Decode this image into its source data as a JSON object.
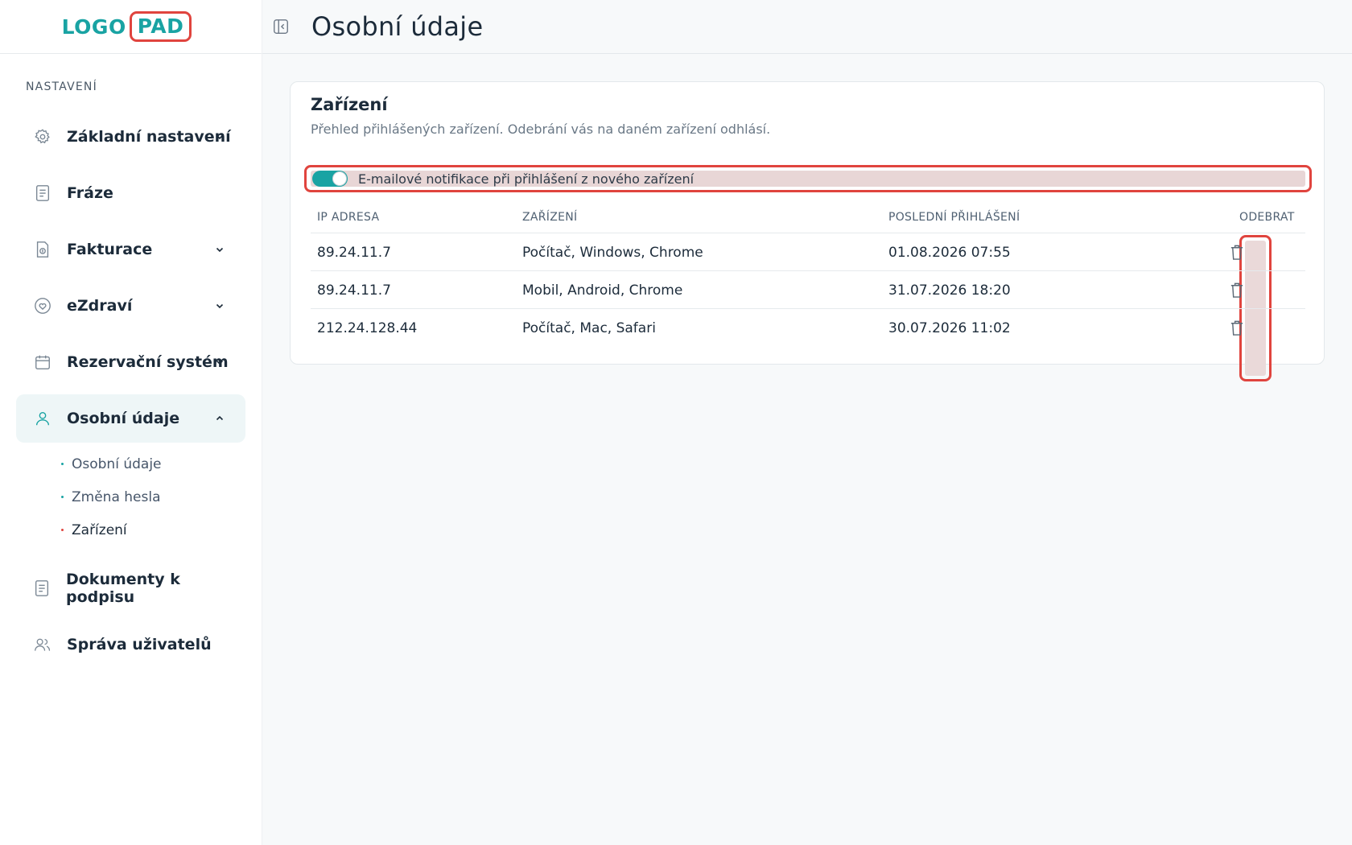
{
  "logo": {
    "part1": "LOGO",
    "part2": "PAD"
  },
  "header": {
    "title": "Osobní údaje"
  },
  "sidebar": {
    "section_label": "NASTAVENÍ",
    "items": [
      {
        "label": "Základní nastavení",
        "icon": "gear-icon"
      },
      {
        "label": "Fráze",
        "icon": "document-icon"
      },
      {
        "label": "Fakturace",
        "icon": "invoice-icon"
      },
      {
        "label": "eZdraví",
        "icon": "heart-icon"
      },
      {
        "label": "Rezervační systém",
        "icon": "calendar-icon"
      },
      {
        "label": "Osobní údaje",
        "icon": "user-icon"
      },
      {
        "label": "Dokumenty k podpisu",
        "icon": "document-icon"
      },
      {
        "label": "Správa uživatelů",
        "icon": "users-icon"
      }
    ],
    "subitems": [
      {
        "label": "Osobní údaje"
      },
      {
        "label": "Změna hesla"
      },
      {
        "label": "Zařízení"
      }
    ]
  },
  "card": {
    "title": "Zařízení",
    "description": "Přehled přihlášených zařízení. Odebrání vás na daném zařízení odhlásí.",
    "notification": {
      "label": "E-mailové notifikace při přihlášení z nového zařízení",
      "enabled": true
    },
    "columns": [
      "IP ADRESA",
      "ZAŘÍZENÍ",
      "POSLEDNÍ PŘIHLÁŠENÍ",
      "ODEBRAT"
    ],
    "rows": [
      {
        "ip": "89.24.11.7",
        "device": "Počítač, Windows, Chrome",
        "last_login": "01.08.2026 07:55"
      },
      {
        "ip": "89.24.11.7",
        "device": "Mobil, Android, Chrome",
        "last_login": "31.07.2026 18:20"
      },
      {
        "ip": "212.24.128.44",
        "device": "Počítač, Mac, Safari",
        "last_login": "30.07.2026 11:02"
      }
    ]
  },
  "colors": {
    "accent": "#19a3a3",
    "highlight": "#e0443e",
    "text": "#1c2b3a"
  }
}
